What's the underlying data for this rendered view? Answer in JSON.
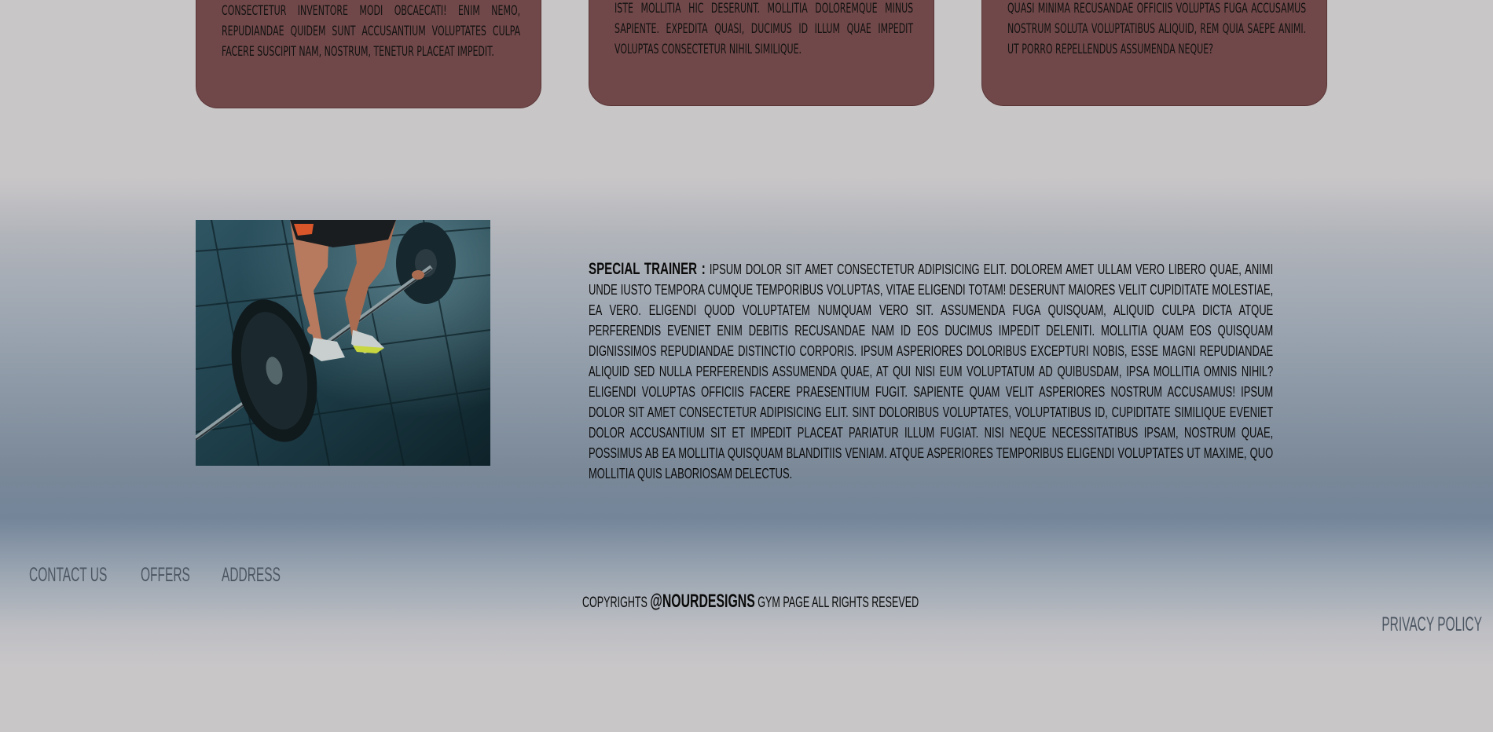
{
  "cards": [
    {
      "text": "consectetur inventore modi obcaecati! Enim nemo, repudiandae quidem sunt accusantium voluptates culpa facere suscipit nam, nostrum, tenetur placeat impedit."
    },
    {
      "text": "iste mollitia hic deserunt. Mollitia doloremque minus sapiente. Expedita quasi, ducimus id illum quae impedit voluptas consectetur nihil similique."
    },
    {
      "text": "quasi minima recusandae officiis voluptas fuga accusamus nostrum soluta voluptatibus aliquid, rem quia saepe animi. Ut porro repellendus assumenda neque?"
    }
  ],
  "about": {
    "heading": "Special trainer :",
    "body": "Ipsum dolor sit amet consectetur adipisicing elit. Dolorem amet ullam vero libero quae, animi unde iusto tempora cumque temporibus voluptas, vitae eligendi totam! Deserunt maiores velit cupiditate molestiae, ea vero. Eligendi quod voluptatem numquam vero sit. Assumenda fuga quisquam, aliquid culpa dicta atque perferendis eveniet enim debitis recusandae nam id eos ducimus impedit deleniti. Mollitia quam eos quisquam dignissimos repudiandae distinctio corporis. Ipsum asperiores doloribus excepturi nobis, esse magni repudiandae aliquid sed nulla perferendis assumenda quae, at qui nisi eum voluptatum ad quibusdam, ipsa mollitia omnis nihil? Eligendi voluptas officiis facere praesentium fugit. Sapiente quam velit asperiores nostrum accusamus! Ipsum dolor sit amet consectetur adipisicing elit. Sint doloribus voluptates, voluptatibus id, cupiditate similique eveniet dolor accusantium sit et impedit placeat pariatur illum fugiat. Nisi neque necessitatibus ipsam, nostrum quae, possimus ab ea mollitia quisquam blanditiis veniam. Atque asperiores temporibus eligendi voluptates ut maxime, quo mollitia quis laboriosam delectus."
  },
  "footer": {
    "links": [
      "Contact us",
      "Offers",
      "Address"
    ],
    "copyright_prefix": "Copyrights",
    "brand": "@NourDesigns",
    "copyright_suffix": "Gym page all rights reseved",
    "privacy": "Privacy policy"
  },
  "colors": {
    "card_bg": "#714849",
    "footer_link": "#4c5662",
    "text": "#0b0b0b"
  }
}
